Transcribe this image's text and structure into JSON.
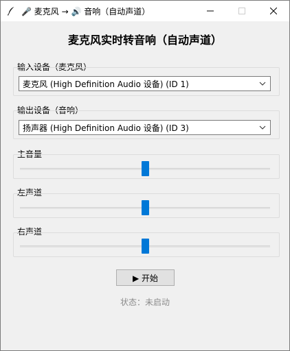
{
  "window": {
    "title": "🎤 麦克风 → 🔊 音响（自动声道）"
  },
  "heading": "麦克风实时转音响（自动声道）",
  "input_device": {
    "label": "输入设备（麦克风）",
    "selected": "麦克风 (High Definition Audio 设备) (ID 1)"
  },
  "output_device": {
    "label": "输出设备（音响）",
    "selected": "扬声器 (High Definition Audio 设备) (ID 3)"
  },
  "sliders": [
    {
      "label": "主音量",
      "value": 0.5
    },
    {
      "label": "左声道",
      "value": 0.5
    },
    {
      "label": "右声道",
      "value": 0.5
    }
  ],
  "start_button": {
    "label": "▶ 开始"
  },
  "status": "状态：未启动",
  "colors": {
    "accent": "#0078d7",
    "background": "#f0f0f0",
    "status_text": "#8c8c8c"
  }
}
